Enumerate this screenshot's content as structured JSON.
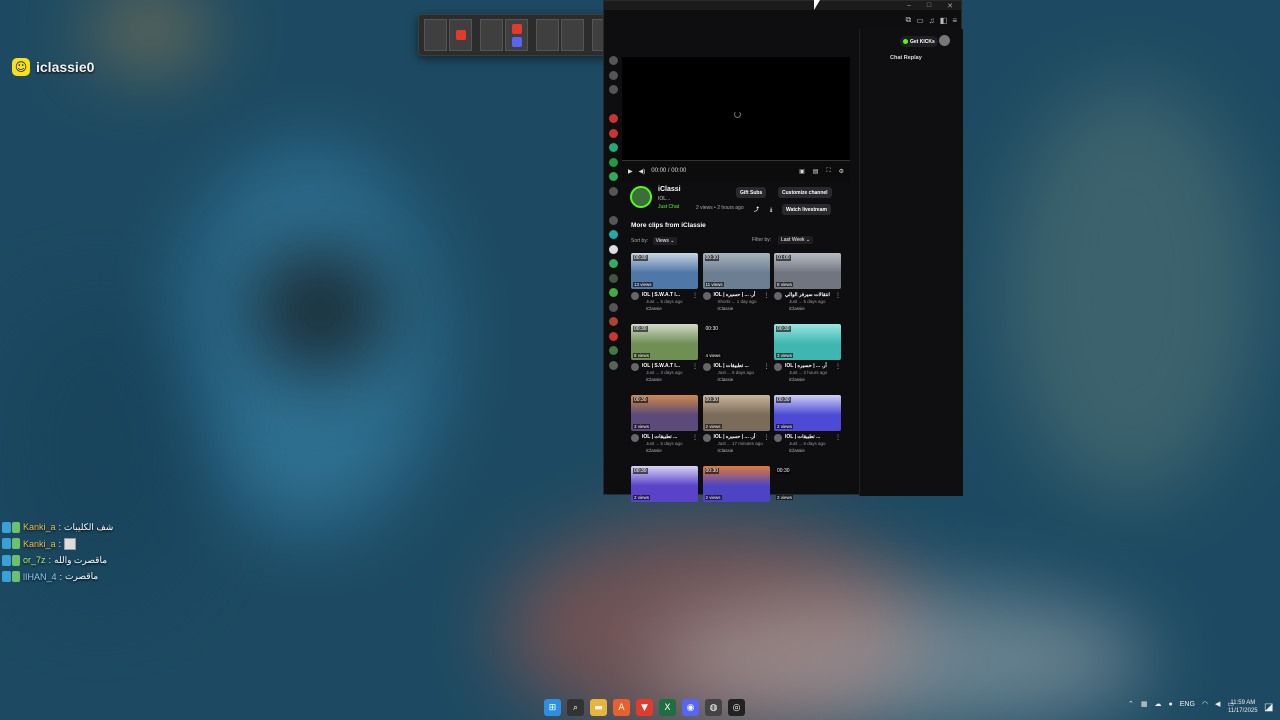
{
  "overlay": {
    "streamer_name": "iclassie0",
    "snap_icon": "snapchat-icon"
  },
  "chat": [
    {
      "user": "Kanki_a",
      "sep": ":",
      "msg": "شف الكليبات",
      "color": "#f1c04a",
      "emote": false
    },
    {
      "user": "Kanki_a",
      "sep": ":",
      "msg": "",
      "color": "#f1c04a",
      "emote": true
    },
    {
      "user": "or_7z",
      "sep": ":",
      "msg": "ماقصرت والله",
      "color": "#b7f06b",
      "emote": false
    },
    {
      "user": "lIHAN_4",
      "sep": ":",
      "msg": "ماقصرت",
      "color": "#8ed0ff",
      "emote": false
    }
  ],
  "window": {
    "titlebar": {
      "minimize": "–",
      "maximize": "□",
      "close": "✕"
    },
    "toolbar_icons": [
      "extensions-icon",
      "sidebar-icon",
      "music-icon",
      "split-icon",
      "menu-icon"
    ],
    "player": {
      "time": "00:00 / 00:00"
    },
    "channel": {
      "name": "iClassi",
      "subtitle": "IOL...",
      "category": "Just Chat",
      "meta": "2 views • 2 hours ago",
      "gift_subs": "Gift Subs",
      "customize": "Customize channel",
      "watch_livestream": "Watch livestream"
    },
    "more_clips_title": "More clips from iClassie",
    "sort_label": "Sort by:",
    "sort_value": "Views",
    "filter_label": "Filter by:",
    "filter_value": "Last Week",
    "chat_panel": {
      "kick_button": "Get KICKs",
      "chat_replay": "Chat Replay"
    }
  },
  "clips": [
    {
      "dur": "00:30",
      "views": "13 views",
      "title": "IOL | S.W.A.T I...",
      "sub": "Just ... 5 days ago",
      "ch": "iClassie",
      "color": "#4f77a8",
      "accent": "#c8d4e0"
    },
    {
      "dur": "00:30",
      "views": "11 views",
      "title": "IOL | أر. ... | حسيره",
      "sub": "Shorts ... 1 day ago",
      "ch": "iClassie",
      "color": "#6c7f92",
      "accent": "#a7b3bd"
    },
    {
      "dur": "01:00",
      "views": "8 views",
      "title": "انتقالات سيرفر الوالي",
      "sub": "Just ... 5 days ago",
      "ch": "iClassie",
      "color": "#707580",
      "accent": "#b9bcc2"
    },
    {
      "dur": "00:30",
      "views": "8 views",
      "title": "IOL | S.W.A.T I...",
      "sub": "Just ... 3 days ago",
      "ch": "iClassie",
      "color": "#6f8f55",
      "accent": "#d4d8c8"
    },
    {
      "dur": "00:30",
      "views": "4 views",
      "title": "IOL | تطبيقات ...",
      "sub": "Just ... 6 days ago",
      "ch": "iClassie",
      "color": "#0e0e10",
      "accent": "#0e0e10"
    },
    {
      "dur": "00:30",
      "views": "3 views",
      "title": "IOL | أر. ... | حسيره",
      "sub": "Just ... 2 hours ago",
      "ch": "iClassie",
      "color": "#3fb6b0",
      "accent": "#9be6e0"
    },
    {
      "dur": "00:30",
      "views": "3 views",
      "title": "IOL | تطبيقات ...",
      "sub": "Just ... 5 days ago",
      "ch": "iClassie",
      "color": "#5b4a7a",
      "accent": "#d08a4a"
    },
    {
      "dur": "00:30",
      "views": "2 views",
      "title": "IOL | أر. ... | حسيره",
      "sub": "Just ... 17 minutes ago",
      "ch": "iClassie",
      "color": "#7a6b5a",
      "accent": "#c9b59a"
    },
    {
      "dur": "00:30",
      "views": "2 views",
      "title": "IOL | تطبيقات ...",
      "sub": "Just ... 6 days ago",
      "ch": "iClassie",
      "color": "#4d4bd6",
      "accent": "#cfd0f5"
    },
    {
      "dur": "00:30",
      "views": "2 views",
      "title": "",
      "sub": "",
      "ch": "",
      "color": "#5a43c9",
      "accent": "#d8d4f5"
    },
    {
      "dur": "00:30",
      "views": "2 views",
      "title": "",
      "sub": "",
      "ch": "",
      "color": "#4d44c4",
      "accent": "#e07a3a"
    },
    {
      "dur": "00:30",
      "views": "2 views",
      "title": "",
      "sub": "",
      "ch": "",
      "color": "#0e0e10",
      "accent": "#0e0e10"
    }
  ],
  "switcher_icons": [
    "brave-icon",
    "discord-icon"
  ],
  "taskbar": {
    "apps": [
      {
        "name": "start-icon",
        "glyph": "⊞",
        "color": "#2d8fe0"
      },
      {
        "name": "search-icon",
        "glyph": "⌕",
        "color": "#333"
      },
      {
        "name": "file-explorer-icon",
        "glyph": "▬",
        "color": "#e8b43a"
      },
      {
        "name": "adobe-icon",
        "glyph": "A",
        "color": "#e8612c"
      },
      {
        "name": "brave-icon",
        "glyph": "▼",
        "color": "#e33b2b"
      },
      {
        "name": "excel-icon",
        "glyph": "X",
        "color": "#1d6f42"
      },
      {
        "name": "discord-icon",
        "glyph": "◉",
        "color": "#5865f2"
      },
      {
        "name": "game-icon",
        "glyph": "◍",
        "color": "#444"
      },
      {
        "name": "obs-icon",
        "glyph": "◎",
        "color": "#222"
      }
    ],
    "tray_lang": "ENG",
    "time": "11:59 AM",
    "date": "11/17/2025"
  }
}
